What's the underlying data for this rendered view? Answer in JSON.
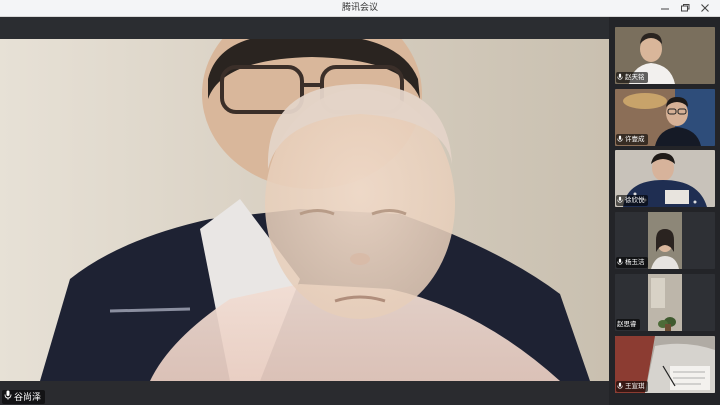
{
  "window": {
    "title": "腾讯会议"
  },
  "main_video": {
    "speaker_name": "谷尚泽"
  },
  "participants": [
    {
      "name": "赵天铭"
    },
    {
      "name": "许壹成"
    },
    {
      "name": "徐欣悦"
    },
    {
      "name": "杨玉洁"
    },
    {
      "name": "赵思睿"
    },
    {
      "name": "王宣琪"
    }
  ],
  "icons": {
    "minimize": "minimize-icon",
    "maximize": "restore-icon",
    "close": "close-icon",
    "mic": "microphone-icon"
  },
  "colors": {
    "titlebar": "#f4f5f7",
    "sidebar": "#232428",
    "stage_bg": "#2b2d31"
  }
}
